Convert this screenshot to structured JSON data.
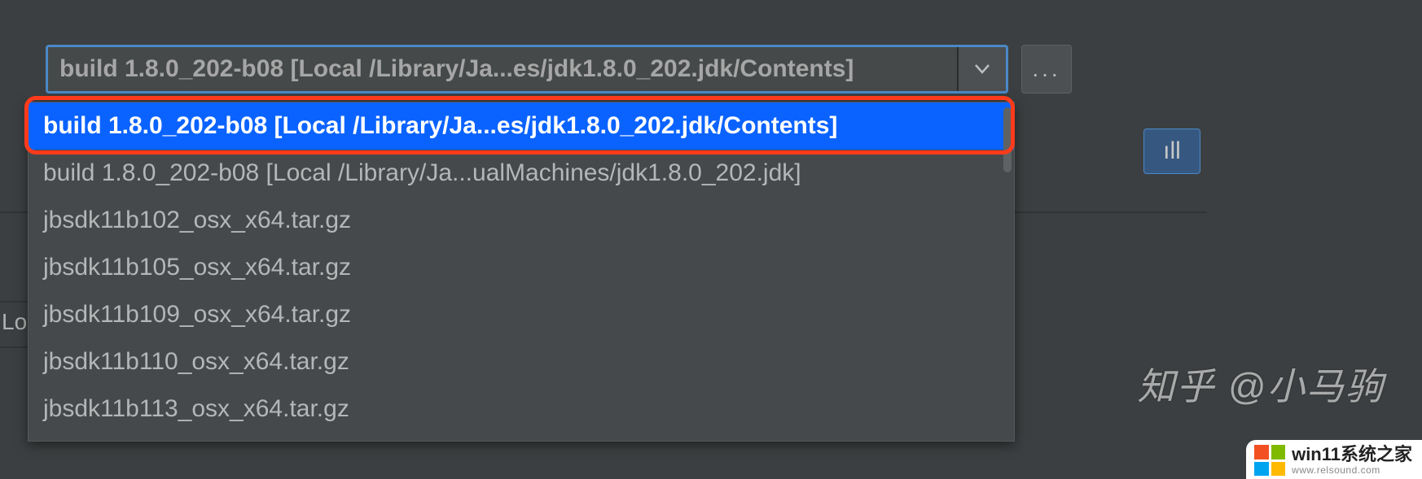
{
  "combo": {
    "selected_text": "build 1.8.0_202-b08 [Local /Library/Ja...es/jdk1.8.0_202.jdk/Contents]"
  },
  "browse_button": {
    "label": "..."
  },
  "all_button": {
    "label": "ıll"
  },
  "dropdown": {
    "items": [
      "build 1.8.0_202-b08 [Local /Library/Ja...es/jdk1.8.0_202.jdk/Contents]",
      "build 1.8.0_202-b08 [Local /Library/Ja...ualMachines/jdk1.8.0_202.jdk]",
      "jbsdk11b102_osx_x64.tar.gz",
      "jbsdk11b105_osx_x64.tar.gz",
      "jbsdk11b109_osx_x64.tar.gz",
      "jbsdk11b110_osx_x64.tar.gz",
      "jbsdk11b113_osx_x64.tar.gz"
    ],
    "selected_index": 0
  },
  "background": {
    "left_label": "Lo"
  },
  "watermarks": {
    "zhihu": "知乎 @小马驹",
    "win11_title": "win11系统之家",
    "win11_sub": "www.relsound.com"
  }
}
